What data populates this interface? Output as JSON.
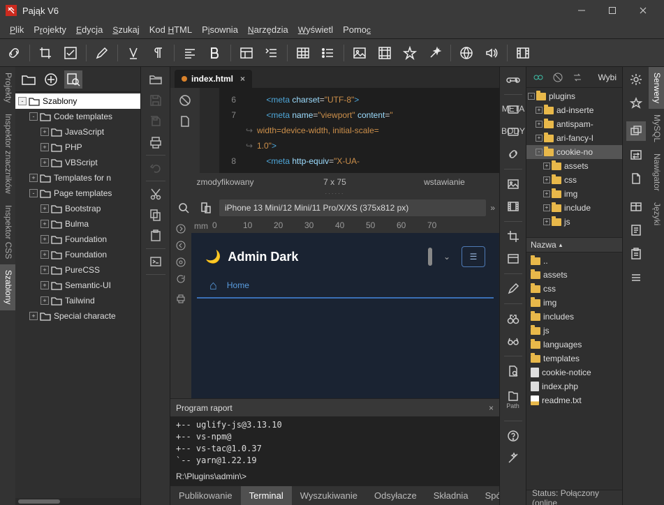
{
  "title": "Pająk  V6",
  "menu": [
    "Plik",
    "Projekty",
    "Edycja",
    "Szukaj",
    "Kod HTML",
    "Pisownia",
    "Narzędzia",
    "Wyświetl",
    "Pomoc"
  ],
  "left_vtabs": [
    "Projekty",
    "Inspektor znaczników",
    "Inspektor CSS",
    "Szablony"
  ],
  "left_vtab_active": 3,
  "right_vtabs": [
    "Serwery",
    "MySQL",
    "Nawigator",
    "Języki"
  ],
  "right_vtab_active": 0,
  "tree_root": "Szablony",
  "tree": [
    {
      "d": 0,
      "exp": "-",
      "label": "Szablony",
      "sel": true
    },
    {
      "d": 1,
      "exp": "-",
      "label": "Code templates"
    },
    {
      "d": 2,
      "exp": "",
      "label": "JavaScript",
      "box": "+"
    },
    {
      "d": 2,
      "exp": "",
      "label": "PHP",
      "box": "+"
    },
    {
      "d": 2,
      "exp": "",
      "label": "VBScript",
      "box": "+"
    },
    {
      "d": 1,
      "exp": "+",
      "label": "Templates for n",
      "box": "+"
    },
    {
      "d": 1,
      "exp": "-",
      "label": "Page templates",
      "box": "+"
    },
    {
      "d": 2,
      "exp": "",
      "label": "Bootstrap",
      "box": "+"
    },
    {
      "d": 2,
      "exp": "",
      "label": "Bulma",
      "box": "+"
    },
    {
      "d": 2,
      "exp": "",
      "label": "Foundation",
      "box": "+"
    },
    {
      "d": 2,
      "exp": "",
      "label": "Foundation",
      "box": "+"
    },
    {
      "d": 2,
      "exp": "",
      "label": "PureCSS",
      "box": "+"
    },
    {
      "d": 2,
      "exp": "",
      "label": "Semantic-UI",
      "box": "+"
    },
    {
      "d": 2,
      "exp": "",
      "label": "Tailwind",
      "box": "+"
    },
    {
      "d": 1,
      "exp": "+",
      "label": "Special characte",
      "box": "+"
    }
  ],
  "editor_tab": "index.html",
  "code": {
    "lines": [
      {
        "n": "6",
        "wrap": "",
        "html": "    <span class='c-tag'>&lt;meta</span> <span class='c-attr'>charset</span>=<span class='c-str'>\"UTF-8\"</span><span class='c-tag'>&gt;</span>"
      },
      {
        "n": "7",
        "wrap": "",
        "html": "    <span class='c-tag'>&lt;meta</span> <span class='c-attr'>name</span>=<span class='c-str'>\"viewport\"</span> <span class='c-attr'>content</span>=<span class='c-str'>\"</span>"
      },
      {
        "n": "",
        "wrap": "↪",
        "html": "<span class='c-str'>width=device-width, initial-scale=</span>"
      },
      {
        "n": "",
        "wrap": "↪",
        "html": "<span class='c-str'>1.0\"</span><span class='c-tag'>&gt;</span>"
      },
      {
        "n": "8",
        "wrap": "",
        "html": "    <span class='c-tag'>&lt;meta</span> <span class='c-attr'>http-equiv</span>=<span class='c-str'>\"X-UA-</span>"
      }
    ]
  },
  "status": {
    "c1": "zmodyfikowany",
    "c2": "7 x 75",
    "c3": "wstawianie"
  },
  "device": "iPhone 13 Mini/12 Mini/11 Pro/X/XS (375x812 px)",
  "ruler_ticks": [
    "0",
    "10",
    "20",
    "30",
    "40",
    "50",
    "60",
    "70"
  ],
  "ruler_units": "mm",
  "preview": {
    "brand": "Admin Dark",
    "nav1": "Home"
  },
  "raport_title": "Program raport",
  "term_lines": [
    "+-- uglify-js@3.13.10",
    "+-- vs-npm@",
    "+-- vs-tac@1.0.37",
    "`-- yarn@1.22.19"
  ],
  "term_prompt": "R:\\Plugins\\admin\\>",
  "bottom_tabs": [
    "Publikowanie",
    "Terminal",
    "Wyszukiwanie",
    "Odsyłacze",
    "Składnia",
    "Spójność"
  ],
  "bottom_active": 1,
  "path_label": "Path",
  "right_label": "Wybi",
  "server_tree": [
    {
      "d": 0,
      "exp": "-",
      "label": "plugins"
    },
    {
      "d": 1,
      "exp": "+",
      "label": "ad-inserte"
    },
    {
      "d": 1,
      "exp": "+",
      "label": "antispam-"
    },
    {
      "d": 1,
      "exp": "+",
      "label": "ari-fancy-l"
    },
    {
      "d": 1,
      "exp": "-",
      "label": "cookie-no",
      "sel": true
    },
    {
      "d": 2,
      "exp": "+",
      "label": "assets"
    },
    {
      "d": 2,
      "exp": "+",
      "label": "css"
    },
    {
      "d": 2,
      "exp": "+",
      "label": "img"
    },
    {
      "d": 2,
      "exp": "+",
      "label": "include"
    },
    {
      "d": 2,
      "exp": "+",
      "label": "js"
    }
  ],
  "nazwa": "Nazwa",
  "file_list": [
    {
      "t": "fold",
      "label": ".."
    },
    {
      "t": "fold",
      "label": "assets"
    },
    {
      "t": "fold",
      "label": "css"
    },
    {
      "t": "fold",
      "label": "img"
    },
    {
      "t": "fold",
      "label": "includes"
    },
    {
      "t": "fold",
      "label": "js"
    },
    {
      "t": "fold",
      "label": "languages"
    },
    {
      "t": "fold",
      "label": "templates"
    },
    {
      "t": "file",
      "label": "cookie-notice"
    },
    {
      "t": "file",
      "label": "index.php"
    },
    {
      "t": "file",
      "label": "readme.txt",
      "icon": "readme"
    }
  ],
  "status_right": "Status: Połączony (online"
}
